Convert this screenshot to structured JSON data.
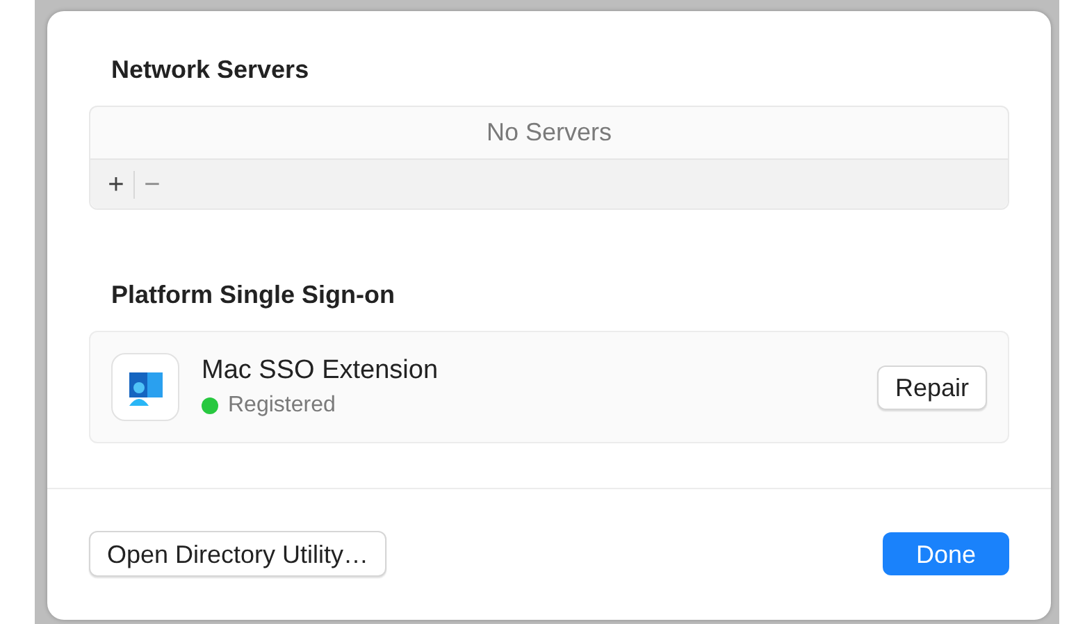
{
  "network_servers": {
    "title": "Network Servers",
    "empty_text": "No Servers",
    "controls": [
      {
        "label": "+",
        "disabled": false
      },
      {
        "label": "−",
        "disabled": true
      }
    ]
  },
  "sso": {
    "title": "Platform Single Sign-on",
    "extension": {
      "name": "Mac SSO Extension",
      "status": "Registered",
      "color": "#28c840",
      "button": "Repair"
    }
  },
  "footer_buttons": [
    {
      "label": "Open Directory Utility…",
      "kind": "secondary"
    },
    {
      "label": "Done",
      "kind": "primary"
    }
  ]
}
